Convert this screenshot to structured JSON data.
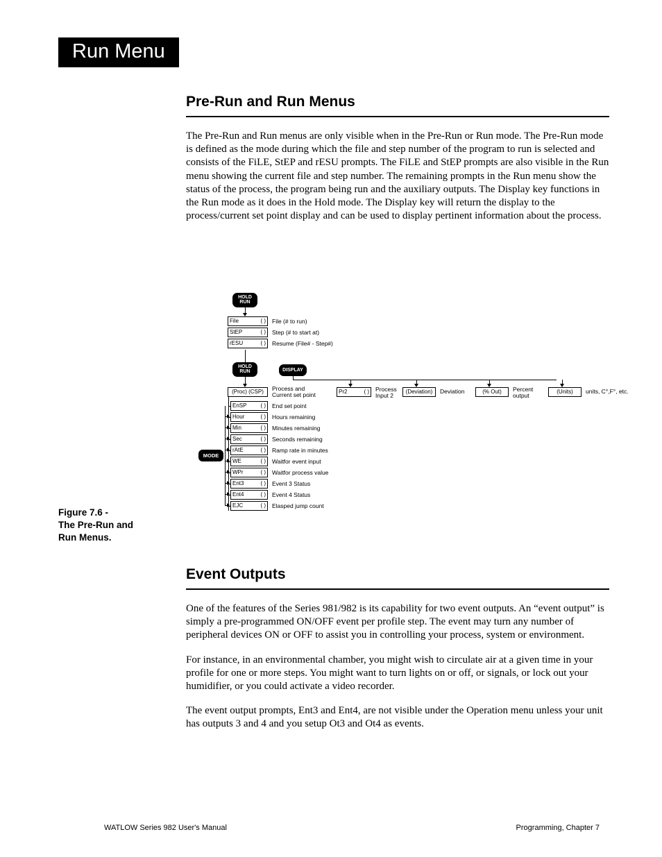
{
  "tab": "Run Menu",
  "section1": {
    "title": "Pre-Run and Run Menus",
    "para": "The Pre-Run and Run menus are only visible when in the Pre-Run or Run mode.  The Pre-Run mode is defined as the mode during which the file and step number of the program to run is selected and consists of the FiLE, StEP and rESU prompts.  The FiLE and StEP prompts are also visible in the Run menu showing the current file and step number.  The remaining prompts in the Run menu show the status of the process, the program being run and the auxiliary outputs.  The Display key functions in the Run mode as it does in the Hold mode.  The Display key will return the display to the process/current set point display and can be used to display pertinent information about the process."
  },
  "figcap": {
    "l1": "Figure 7.6 -",
    "l2": "The Pre-Run and",
    "l3": "Run Menus."
  },
  "diagram": {
    "holdrun1_top": "HOLD",
    "holdrun1_bot": "RUN",
    "holdrun2_top": "HOLD",
    "holdrun2_bot": "RUN",
    "display": "DISPLAY",
    "mode": "MODE",
    "paren": "(  )",
    "rows1": [
      {
        "k": "File",
        "d": "File (# to run)"
      },
      {
        "k": "StEP",
        "d": "Step (# to start at)"
      },
      {
        "k": "rESU",
        "d": "Resume (File# - Step#)"
      }
    ],
    "proccsp": "(Proc) (CSP)",
    "proccsp_d1": "Process and",
    "proccsp_d2": "Current set point",
    "branch": [
      {
        "box": "Pr2",
        "paren": true,
        "d1": "Process",
        "d2": "Input 2"
      },
      {
        "box": "(Deviation)",
        "paren": false,
        "d1": "Deviation",
        "d2": ""
      },
      {
        "box": "(% Out)",
        "paren": false,
        "d1": "Percent",
        "d2": "output"
      },
      {
        "box": "(Units)",
        "paren": false,
        "d1": "units, C°,F°, etc.",
        "d2": ""
      }
    ],
    "rows2": [
      {
        "k": "EnSP",
        "d": "End set point"
      },
      {
        "k": "Hour",
        "d": "Hours remaining"
      },
      {
        "k": "Min",
        "d": "Minutes remaining"
      },
      {
        "k": "Sec",
        "d": "Seconds remaining"
      },
      {
        "k": "rAtE",
        "d": "Ramp rate in minutes"
      },
      {
        "k": "WE",
        "d": "Waitfor event input"
      },
      {
        "k": "WPr",
        "d": "Waitfor process value"
      },
      {
        "k": "Ent3",
        "d": "Event 3 Status"
      },
      {
        "k": "Ent4",
        "d": "Event 4 Status"
      },
      {
        "k": "EJC",
        "d": "Elasped jump count"
      }
    ]
  },
  "section2": {
    "title": "Event Outputs",
    "p1": "One of the features of the Series 981/982 is its capability for two event outputs.  An “event output” is simply a pre-programmed ON/OFF event per profile step.  The event may turn any number of peripheral devices ON or OFF to assist you in controlling your process, system or environment.",
    "p2": "For instance, in an environmental chamber, you might wish to circulate air at a given time in your profile for one or more steps.  You might want to turn lights on or off, or signals, or lock out your humidifier, or you could activate a video recorder.",
    "p3": "The event output prompts, Ent3 and Ent4, are not visible under the Operation menu unless your unit has outputs 3 and 4 and you setup Ot3 and Ot4 as events."
  },
  "footer": {
    "left": "WATLOW Series 982 User's Manual",
    "right": "Programming, Chapter 7"
  }
}
